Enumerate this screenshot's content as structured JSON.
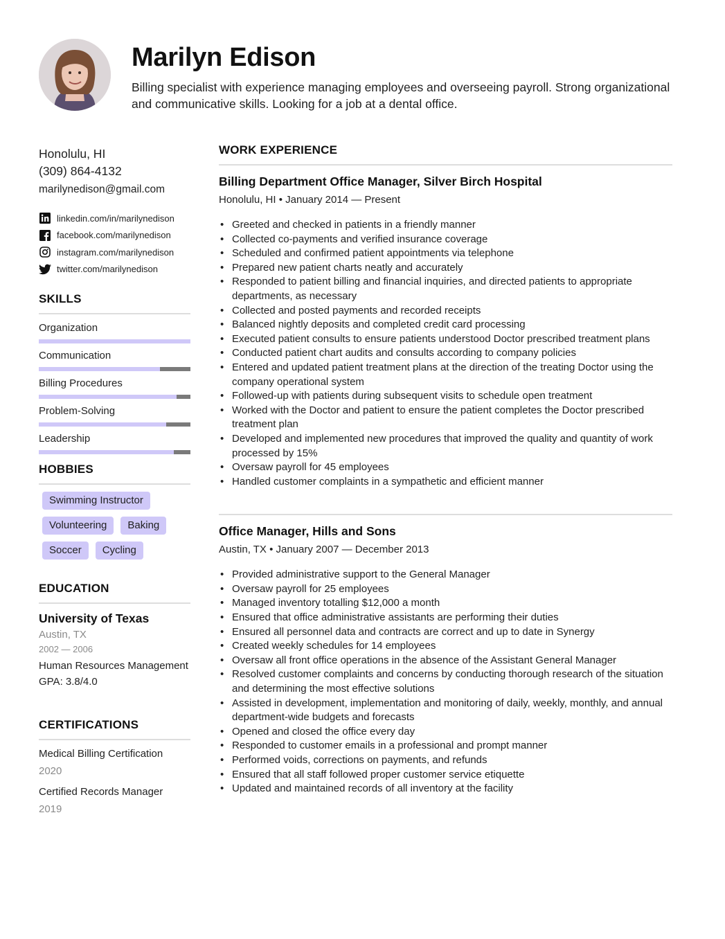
{
  "header": {
    "name": "Marilyn Edison",
    "summary": "Billing specialist with experience managing employees and overseeing payroll. Strong organizational and communicative skills. Looking for a job at a dental office."
  },
  "contact": {
    "location": "Honolulu, HI",
    "phone": "(309) 864-4132",
    "email": "marilynedison@gmail.com",
    "socials": [
      {
        "icon": "linkedin-icon",
        "label": "linkedin.com/in/marilynedison"
      },
      {
        "icon": "facebook-icon",
        "label": "facebook.com/marilynedison"
      },
      {
        "icon": "instagram-icon",
        "label": "instagram.com/marilynedison"
      },
      {
        "icon": "twitter-icon",
        "label": "twitter.com/marilynedison"
      }
    ]
  },
  "colors": {
    "accent": "#cfc8f8",
    "bar_track": "#7a7a7a",
    "rule": "#dddddd",
    "muted_text": "#8a8a8a"
  },
  "skills": {
    "title": "SKILLS",
    "items": [
      {
        "name": "Organization",
        "level": 1.0
      },
      {
        "name": "Communication",
        "level": 0.8
      },
      {
        "name": "Billing Procedures",
        "level": 0.91
      },
      {
        "name": "Problem-Solving",
        "level": 0.84
      },
      {
        "name": "Leadership",
        "level": 0.89
      }
    ]
  },
  "hobbies": {
    "title": "HOBBIES",
    "items": [
      "Swimming Instructor",
      "Volunteering",
      "Baking",
      "Soccer",
      "Cycling"
    ]
  },
  "education": {
    "title": "EDUCATION",
    "school": "University of Texas",
    "location": "Austin, TX",
    "years": "2002 — 2006",
    "degree": "Human Resources Management",
    "gpa": "GPA: 3.8/4.0"
  },
  "certifications": {
    "title": "CERTIFICATIONS",
    "items": [
      {
        "name": "Medical Billing Certification",
        "year": "2020"
      },
      {
        "name": "Certified Records Manager",
        "year": "2019"
      }
    ]
  },
  "work": {
    "title": "WORK EXPERIENCE",
    "jobs": [
      {
        "title": "Billing Department Office Manager, Silver Birch Hospital",
        "meta": "Honolulu, HI • January 2014 — Present",
        "bullets": [
          "Greeted and checked in patients in a friendly manner",
          "Collected co-payments and verified insurance coverage",
          "Scheduled and confirmed patient appointments via telephone",
          "Prepared new patient charts neatly and accurately",
          "Responded to patient billing and financial inquiries, and directed patients to appropriate departments, as necessary",
          "Collected and posted payments and recorded receipts",
          "Balanced nightly deposits and completed credit card processing",
          "Executed patient consults to ensure patients understood Doctor prescribed treatment plans",
          "Conducted patient chart audits and consults according to company policies",
          "Entered and updated patient treatment plans at the direction of the treating Doctor using the company operational system",
          "Followed-up with patients during subsequent visits to schedule open treatment",
          "Worked with the Doctor and patient to ensure the patient completes the Doctor prescribed treatment plan",
          "Developed and implemented new procedures that improved the quality and quantity of work processed by 15%",
          "Oversaw payroll for 45 employees",
          "Handled customer complaints in a sympathetic and efficient manner"
        ]
      },
      {
        "title": "Office Manager, Hills and Sons",
        "meta": "Austin, TX • January 2007 — December 2013",
        "bullets": [
          "Provided administrative support to the General Manager",
          "Oversaw payroll for 25 employees",
          "Managed inventory totalling $12,000 a month",
          "Ensured that office administrative assistants are performing their duties",
          "Ensured all personnel data and contracts are correct and up to date in Synergy",
          "Created weekly schedules for 14 employees",
          "Oversaw all front office operations in the absence of the Assistant General Manager",
          "Resolved customer complaints and concerns by conducting thorough research of the situation and determining the most effective solutions",
          "Assisted in development, implementation and monitoring of daily, weekly, monthly, and annual department-wide budgets and forecasts",
          "Opened and closed the office every day",
          "Responded to customer emails in a professional and prompt manner",
          "Performed voids, corrections on payments, and refunds",
          "Ensured that all staff followed proper customer service etiquette",
          "Updated and maintained records of all inventory at the facility"
        ]
      }
    ]
  }
}
